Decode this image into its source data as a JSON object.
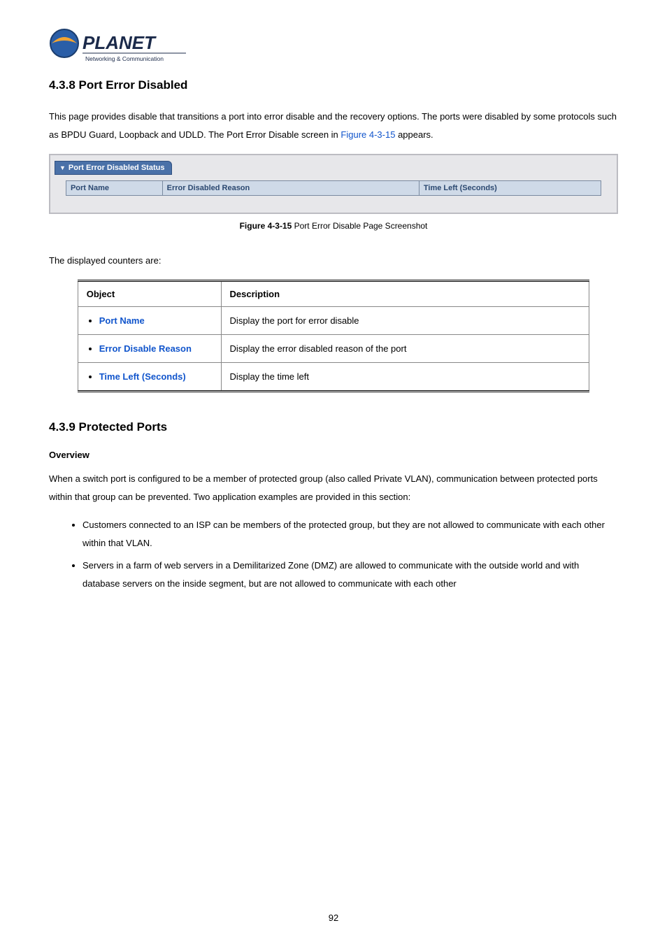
{
  "logo": {
    "brand": "PLANET",
    "tagline": "Networking & Communication"
  },
  "section1": {
    "heading": "4.3.8 Port Error Disabled",
    "para_pre": "This page provides disable that transitions a port into error disable and the recovery options. The ports were disabled by some protocols such as BPDU Guard, Loopback and UDLD. The Port Error Disable screen in ",
    "fig_ref": "Figure 4-3-15",
    "para_post": " appears."
  },
  "screenshot": {
    "tab_label": "Port Error Disabled Status",
    "cols": {
      "c1": "Port Name",
      "c2": "Error Disabled Reason",
      "c3": "Time Left (Seconds)"
    }
  },
  "caption": {
    "label": "Figure 4-3-15",
    "text": " Port Error Disable Page Screenshot"
  },
  "counters_intro": "The displayed counters are:",
  "obj_table": {
    "headers": {
      "object": "Object",
      "description": "Description"
    },
    "rows": [
      {
        "object": "Port Name",
        "description": "Display the port for error disable"
      },
      {
        "object": "Error Disable Reason",
        "description": "Display the error disabled reason of the port"
      },
      {
        "object": "Time Left (Seconds)",
        "description": "Display the time left"
      }
    ]
  },
  "section2": {
    "heading": "4.3.9 Protected Ports",
    "overview_label": "Overview",
    "overview_text": "When a switch port is configured to be a member of protected group (also called Private VLAN), communication between protected ports within that group can be prevented. Two application examples are provided in this section:",
    "bullets": [
      "Customers connected to an ISP can be members of the protected group, but they are not allowed to communicate with each other within that VLAN.",
      "Servers in a farm of web servers in a Demilitarized Zone (DMZ) are allowed to communicate with the outside world and with database servers on the inside segment, but are not allowed to communicate with each other"
    ]
  },
  "page_number": "92"
}
